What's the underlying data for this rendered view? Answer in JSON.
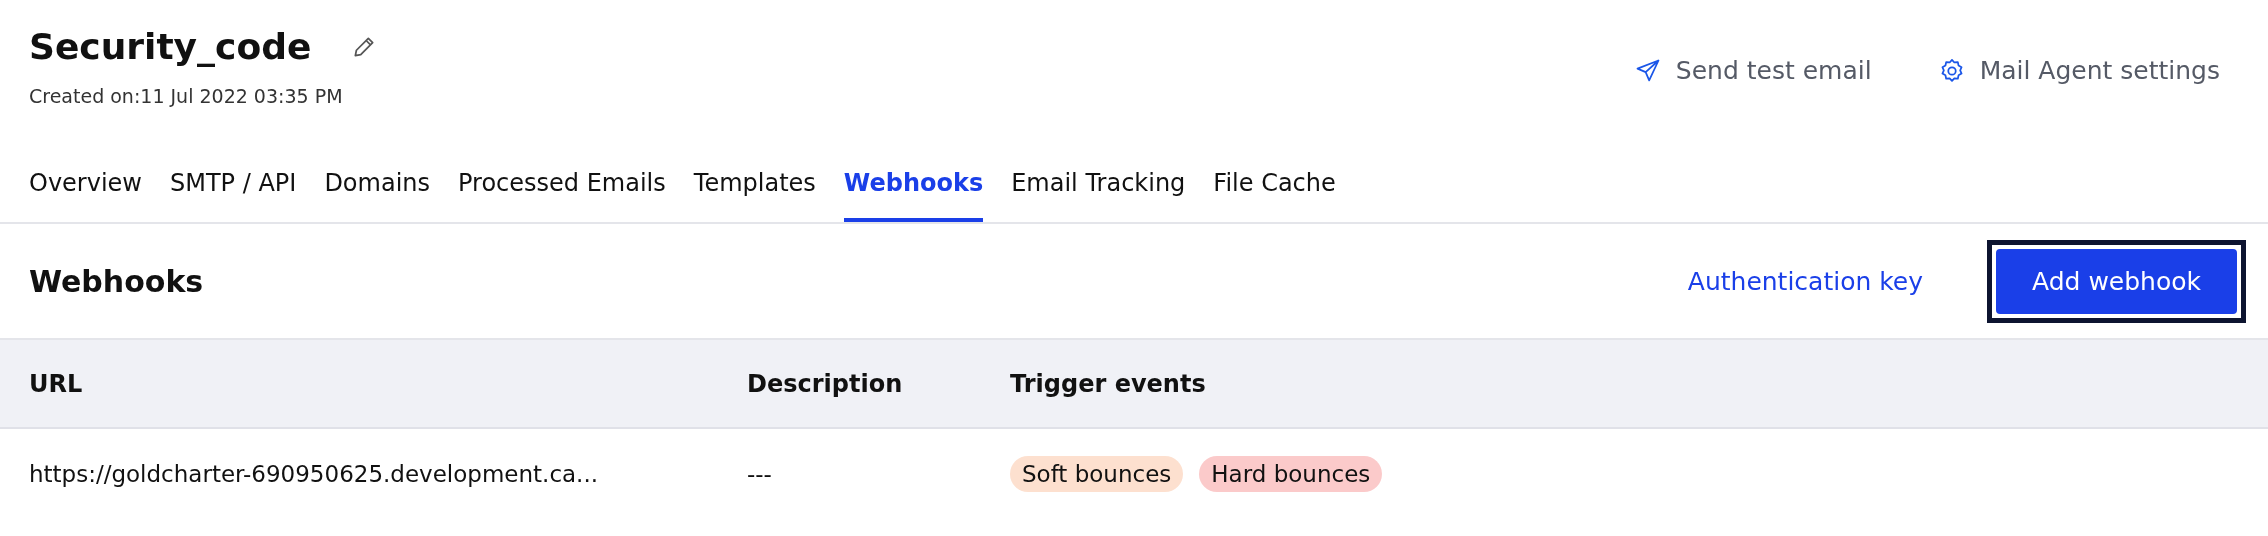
{
  "header": {
    "title": "Security_code",
    "created": "Created on:11 Jul 2022 03:35 PM"
  },
  "actions": [
    {
      "kind": "send",
      "label": "Send test email"
    },
    {
      "kind": "settings",
      "label": "Mail Agent settings"
    }
  ],
  "tabs": [
    {
      "label": "Overview",
      "selected": false
    },
    {
      "label": "SMTP / API",
      "selected": false
    },
    {
      "label": "Domains",
      "selected": false
    },
    {
      "label": "Processed Emails",
      "selected": false
    },
    {
      "label": "Templates",
      "selected": false
    },
    {
      "label": "Webhooks",
      "selected": true
    },
    {
      "label": "Email Tracking",
      "selected": false
    },
    {
      "label": "File Cache",
      "selected": false
    }
  ],
  "section": {
    "title": "Webhooks",
    "link": "Authentication key",
    "button": "Add webhook"
  },
  "table": {
    "columns": [
      "URL",
      "Description",
      "Trigger events"
    ],
    "rows": [
      {
        "url": "https://goldcharter-690950625.development.ca...",
        "description": "---",
        "events": [
          {
            "label": "Soft bounces",
            "color": "#fde0cf"
          },
          {
            "label": "Hard bounces",
            "color": "#fbcaca"
          }
        ]
      }
    ]
  }
}
